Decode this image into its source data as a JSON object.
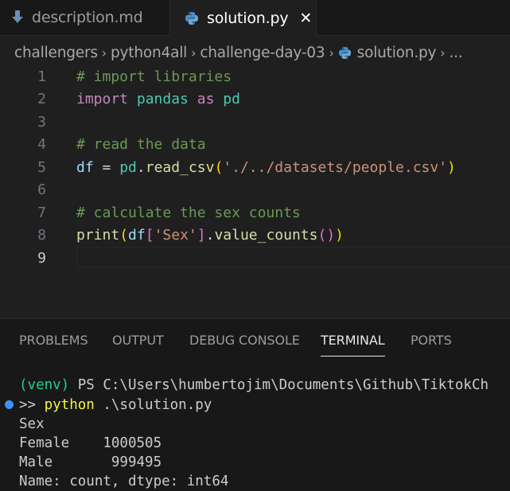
{
  "tabs": [
    {
      "label": "description.md",
      "icon": "download-arrow-icon",
      "active": false
    },
    {
      "label": "solution.py",
      "icon": "python-icon",
      "active": true,
      "close": "✕"
    }
  ],
  "breadcrumb": {
    "items": [
      "challengers",
      "python4all",
      "challenge-day-03",
      "solution.py",
      "..."
    ],
    "separator": "›"
  },
  "editor": {
    "line_numbers": [
      "1",
      "2",
      "3",
      "4",
      "5",
      "6",
      "7",
      "8",
      "9"
    ],
    "current_line": "9",
    "lines": {
      "l1": {
        "comment": "# import libraries"
      },
      "l2": {
        "kw_import": "import",
        "module": "pandas",
        "kw_as": "as",
        "alias": "pd"
      },
      "l4": {
        "comment": "# read the data"
      },
      "l5": {
        "var": "df",
        "eq": " = ",
        "obj": "pd",
        "dot": ".",
        "fn": "read_csv",
        "open": "(",
        "str": "'./../datasets/people.csv'",
        "close": ")"
      },
      "l7": {
        "comment": "# calculate the sex counts"
      },
      "l8": {
        "fn": "print",
        "open": "(",
        "var": "df",
        "bopen": "[",
        "str": "'Sex'",
        "bclose": "]",
        "dot": ".",
        "method": "value_counts",
        "p3open": "(",
        "p3close": ")",
        "close": ")"
      }
    }
  },
  "panel": {
    "tabs": [
      "PROBLEMS",
      "OUTPUT",
      "DEBUG CONSOLE",
      "TERMINAL",
      "PORTS"
    ],
    "active_tab": "TERMINAL"
  },
  "terminal": {
    "prompt_venv": "(venv)",
    "prompt_path": " PS C:\\Users\\humbertojim\\Documents\\Github\\TiktokCh",
    "cont": ">> ",
    "cmd": "python",
    "cmd_arg": " .\\solution.py",
    "out1": "Sex",
    "out2": "Female    1000505",
    "out3": "Male       999495",
    "out4": "Name: count, dtype: int64"
  },
  "colors": {
    "background": "#1f1f1f",
    "comment": "#6a9955",
    "keyword": "#c586c0",
    "string": "#ce9178",
    "accent": "#3794ff"
  }
}
